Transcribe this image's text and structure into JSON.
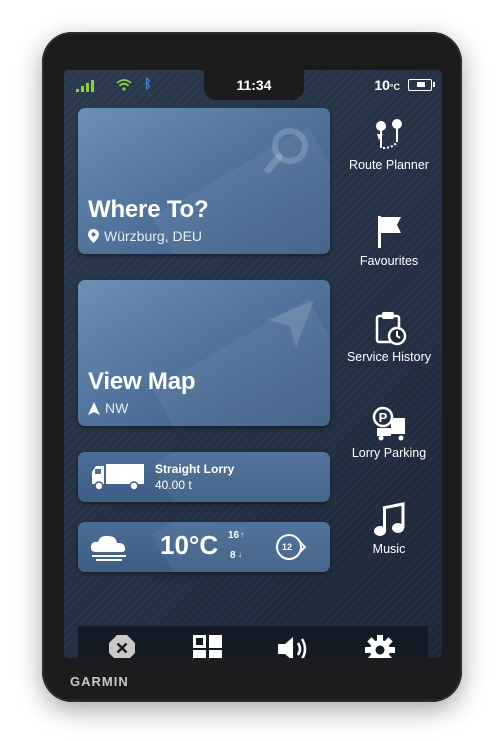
{
  "status": {
    "time": "11:34",
    "temperature": "10",
    "temperature_unit": "°C",
    "signal_icon": "signal-bars-icon",
    "wifi_icon": "wifi-icon",
    "bluetooth_icon": "bluetooth-icon",
    "battery_icon": "battery-icon"
  },
  "tiles": {
    "where_to": {
      "title": "Where To?",
      "location": "Würzburg, DEU"
    },
    "view_map": {
      "title": "View Map",
      "heading": "NW"
    },
    "vehicle": {
      "name": "Straight Lorry",
      "weight": "40.00 t"
    },
    "weather": {
      "temp": "10°C",
      "high": "16",
      "low": "8",
      "speed_limit": "12"
    }
  },
  "side_menu": {
    "route_planner": "Route Planner",
    "favourites": "Favourites",
    "service_history": "Service History",
    "lorry_parking": "Lorry Parking",
    "music": "Music"
  },
  "brand": "GARMIN",
  "colors": {
    "accent_green": "#8bd144",
    "bluetooth_blue": "#3b8fe0",
    "tile_blue": "#4e7099"
  }
}
